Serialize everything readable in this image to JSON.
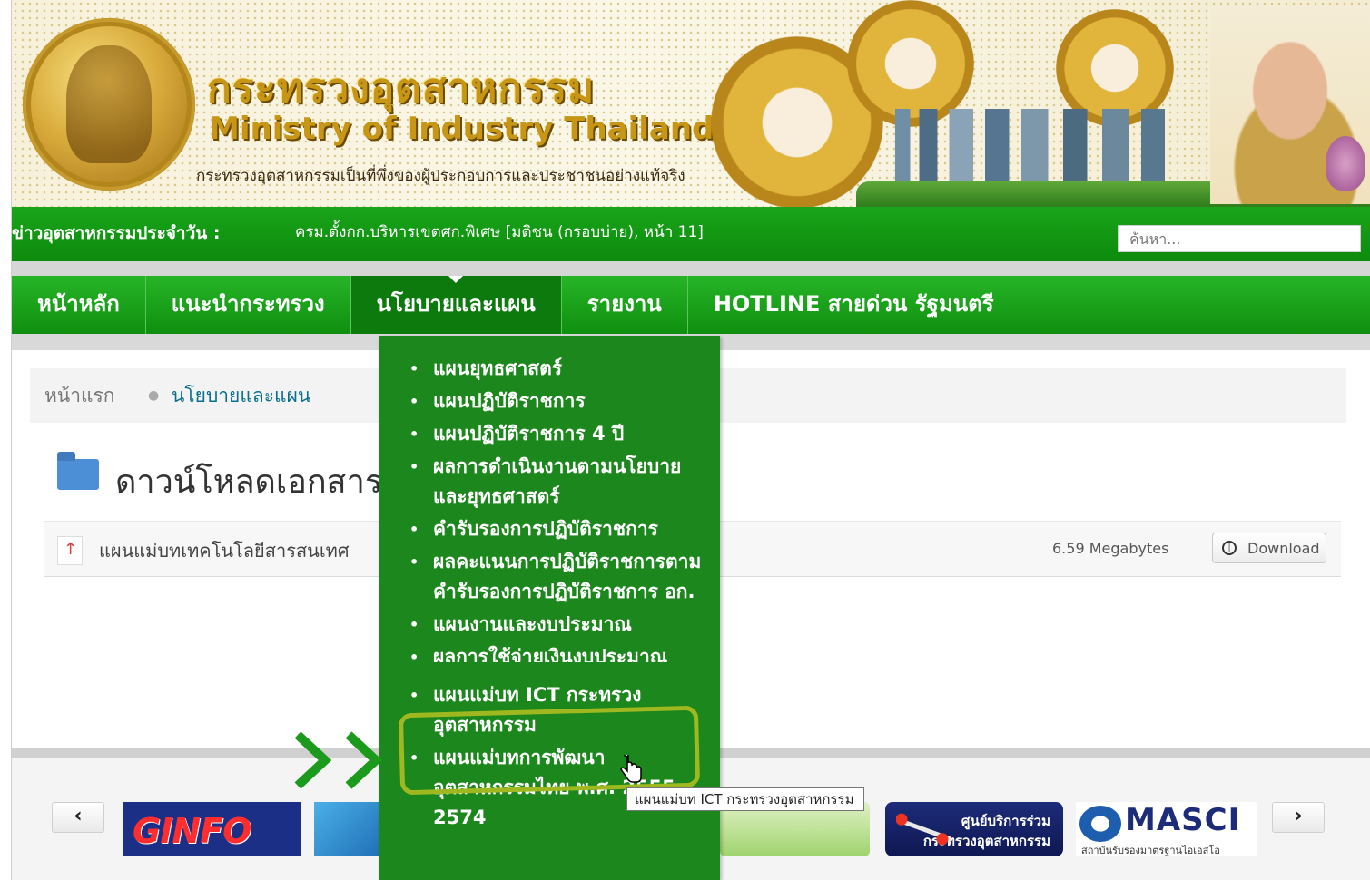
{
  "header": {
    "title_th": "กระทรวงอุตสาหกรรม",
    "title_en": "Ministry of Industry Thailand",
    "slogan": "กระทรวงอุตสาหกรรมเป็นที่พึ่งของผู้ประกอบการและประชาชนอย่างแท้จริง",
    "seal_icon": "royal-seal-icon",
    "portrait_icon": "king-portrait-icon"
  },
  "news": {
    "label": "ข่าวอุตสาหกรรมประจำวัน :",
    "text": "ครม.ตั้งกก.บริหารเขตศก.พิเศษ [มติชน (กรอบบ่าย), หน้า 11]",
    "search_placeholder": "ค้นหา..."
  },
  "nav": {
    "items": [
      {
        "label": "หน้าหลัก"
      },
      {
        "label": "แนะนำกระทรวง"
      },
      {
        "label": "นโยบายและแผน"
      },
      {
        "label": "รายงาน"
      },
      {
        "label": "HOTLINE สายด่วน รัฐมนตรี"
      }
    ],
    "active_index": 2
  },
  "dropdown": {
    "items": [
      "แผนยุทธศาสตร์",
      "แผนปฏิบัติราชการ",
      "แผนปฏิบัติราชการ 4 ปี",
      "ผลการดำเนินงานตามนโยบายและยุทธศาสตร์",
      "คำรับรองการปฏิบัติราชการ",
      "ผลคะแนนการปฏิบัติราชการตามคำรับรองการปฏิบัติราชการ อก.",
      "แผนงานและงบประมาณ",
      "ผลการใช้จ่ายเงินงบประมาณ",
      "แผนแม่บท ICT กระทรวงอุตสาหกรรม",
      "แผนแม่บทการพัฒนาอุตสาหกรรมไทย พ.ศ. 2555-2574"
    ],
    "tooltip": "แผนแม่บท ICT กระทรวงอุตสาหกรรม"
  },
  "breadcrumb": {
    "home": "หน้าแรก",
    "current": "นโยบายและแผน"
  },
  "content": {
    "heading": "ดาวน์โหลดเอกสาร",
    "file_name": "แผนแม่บทเทคโนโลยีสารสนเทศ",
    "file_size": "6.59 Megabytes",
    "download_label": "Download"
  },
  "footer": {
    "prev": "‹",
    "next": "›",
    "logos": {
      "ginfo": "GINFO",
      "center_line1": "ศูนย์บริการร่วม",
      "center_line2": "กระทรวงอุตสาหกรรม",
      "masci": "MASCI",
      "masci_sub": "สถาบันรับรองมาตรฐานไอเอสโอ"
    }
  },
  "colors": {
    "green_primary": "#1aa51a",
    "green_dark": "#0d7a0d",
    "dropdown_bg": "#1c871c",
    "highlight": "#9fb81f",
    "gold": "#c79614"
  }
}
